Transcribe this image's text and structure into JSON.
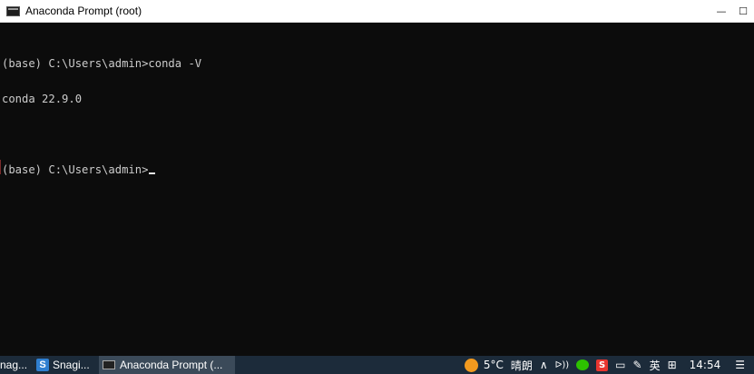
{
  "window": {
    "title": "Anaconda Prompt (root)",
    "controls": {
      "minimize": "—",
      "maximize": "☐",
      "close": "✕"
    }
  },
  "console": {
    "lines": [
      "(base) C:\\Users\\admin>conda -V",
      "conda 22.9.0",
      "",
      "(base) C:\\Users\\admin>"
    ]
  },
  "taskbar": {
    "tasks": [
      {
        "label": "nag...",
        "icon": "app-icon"
      },
      {
        "label": "Snagi...",
        "icon": "snagit-icon"
      },
      {
        "label": "Anaconda Prompt (...",
        "icon": "cmd-icon",
        "active": true
      }
    ],
    "tray": {
      "weather_temp": "5°C",
      "weather_desc": "晴朗",
      "chevron": "∧",
      "volume": "ᐅ))",
      "input_lang": "英",
      "keyboard_glyph": "⊞",
      "clock": "14:54",
      "notification_glyph": "☰"
    }
  },
  "colors": {
    "console_bg": "#0c0c0c",
    "console_fg": "#cccccc",
    "taskbar_bg": "#1c2b3a",
    "titlebar_bg": "#ffffff"
  }
}
